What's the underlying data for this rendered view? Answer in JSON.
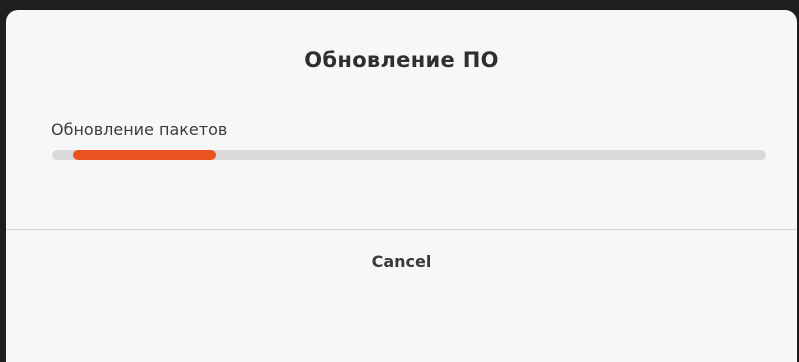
{
  "dialog": {
    "title": "Обновление ПО",
    "status_text": "Обновление пакетов",
    "progress": {
      "mode": "indeterminate",
      "start_fraction": 0.03,
      "fill_fraction": 0.2,
      "accent_color": "#e95420",
      "track_color": "#dadada"
    },
    "cancel_label": "Cancel"
  }
}
